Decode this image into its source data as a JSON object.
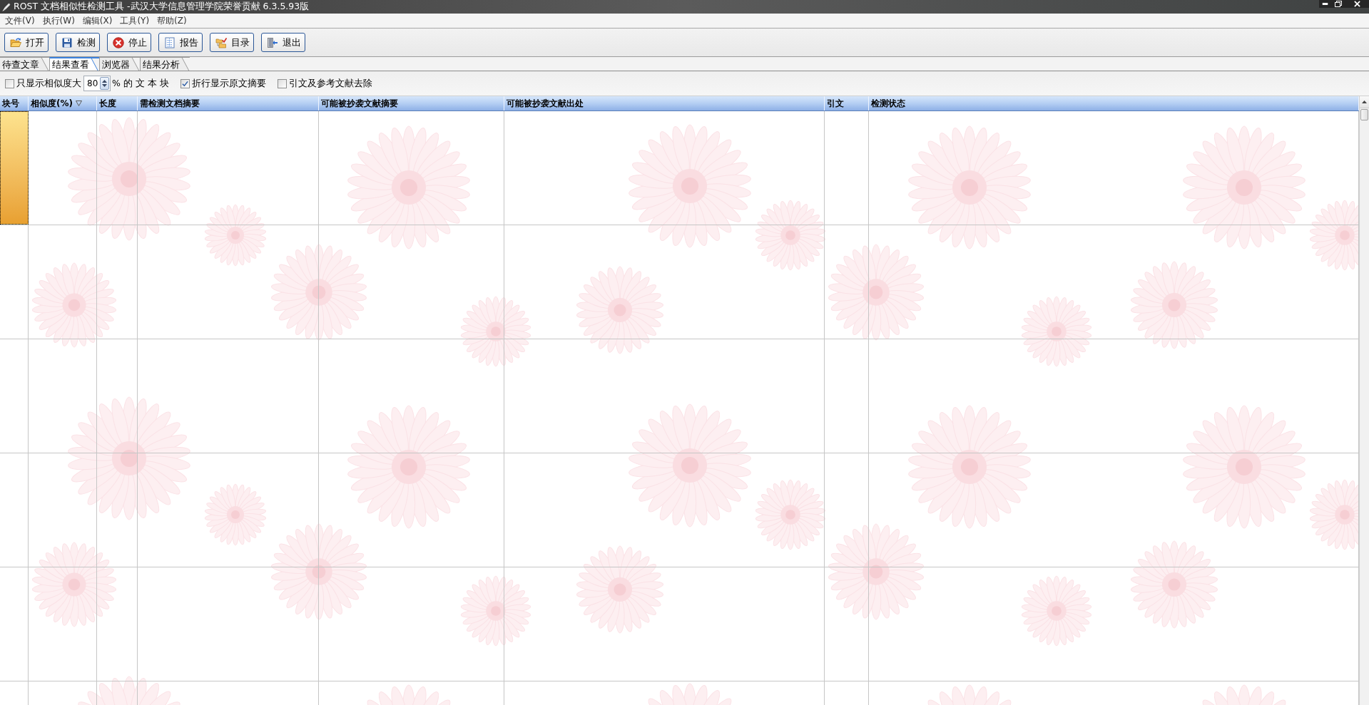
{
  "window": {
    "title": "ROST 文档相似性检测工具 -武汉大学信息管理学院荣誉贡献 6.3.5.93版"
  },
  "menu": [
    "文件(V)",
    "执行(W)",
    "编辑(X)",
    "工具(Y)",
    "帮助(Z)"
  ],
  "toolbar": [
    {
      "kind": "open",
      "label": "打开"
    },
    {
      "kind": "detect",
      "label": "检测"
    },
    {
      "kind": "stop",
      "label": "停止"
    },
    {
      "kind": "report",
      "label": "报告"
    },
    {
      "kind": "catalog",
      "label": "目录"
    },
    {
      "kind": "exit",
      "label": "退出"
    }
  ],
  "tabs": [
    {
      "label": "待查文章",
      "selected": false
    },
    {
      "label": "结果查看",
      "selected": true
    },
    {
      "label": "浏览器",
      "selected": false
    },
    {
      "label": "结果分析",
      "selected": false
    }
  ],
  "options": [
    {
      "kind": "threshold",
      "checked": false,
      "label": "只显示相似度大",
      "value": "80",
      "suffix": "% 的 文 本 块"
    },
    {
      "kind": "checkbox",
      "checked": true,
      "label": "折行显示原文摘要"
    },
    {
      "kind": "checkbox",
      "checked": false,
      "label": "引文及参考文献去除"
    }
  ],
  "table": {
    "columns": [
      {
        "label": "块号",
        "sorted": false
      },
      {
        "label": "相似度(%)",
        "sorted": true
      },
      {
        "label": "长度",
        "sorted": false
      },
      {
        "label": "需检测文档摘要",
        "sorted": false
      },
      {
        "label": "可能被抄袭文献摘要",
        "sorted": false
      },
      {
        "label": "可能被抄袭文献出处",
        "sorted": false
      },
      {
        "label": "引文",
        "sorted": false
      },
      {
        "label": "检测状态",
        "sorted": false
      }
    ],
    "rows": [
      {
        "selected": true
      },
      {
        "selected": false
      },
      {
        "selected": false
      },
      {
        "selected": false
      },
      {
        "selected": false
      },
      {
        "selected": false
      }
    ]
  }
}
